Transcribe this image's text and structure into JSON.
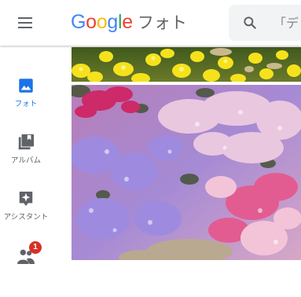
{
  "header": {
    "menu_icon": "hamburger-menu-icon",
    "logo": {
      "letters": [
        "G",
        "o",
        "o",
        "g",
        "l",
        "e"
      ],
      "colors": [
        "#4285f4",
        "#ea4335",
        "#fbbc05",
        "#4285f4",
        "#34a853",
        "#ea4335"
      ]
    },
    "product_name": "フォト"
  },
  "search": {
    "icon": "search-icon",
    "placeholder": "「デ"
  },
  "sidebar": {
    "items": [
      {
        "label": "フォト",
        "icon": "photo-icon",
        "active": true
      },
      {
        "label": "アルバム",
        "icon": "album-icon",
        "active": false
      },
      {
        "label": "アシスタント",
        "icon": "assistant-icon",
        "active": false
      },
      {
        "label": "",
        "icon": "sharing-icon",
        "active": false,
        "badge": "1"
      }
    ]
  },
  "photos": [
    {
      "subject": "yellow flowers",
      "icon": "yellow-flowers-photo"
    },
    {
      "subject": "pink and purple phlox flowers",
      "icon": "phlox-flowers-photo"
    }
  ],
  "colors": {
    "accent": "#1a73e8",
    "icon_gray": "#5f6368",
    "badge_red": "#d93025",
    "search_bg": "#f1f3f4"
  }
}
